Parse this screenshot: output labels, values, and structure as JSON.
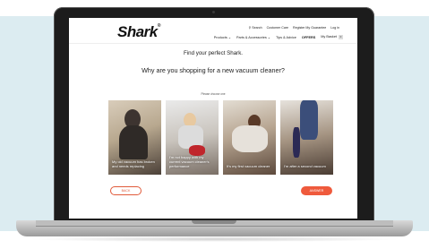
{
  "brand": {
    "logo": "Shark",
    "mark": "®"
  },
  "header": {
    "util_links": [
      "Search",
      "Customer Care",
      "Register My Guarantee",
      "Log in"
    ],
    "nav": {
      "products": "Products ⌄",
      "parts": "Parts & Accessories ⌄",
      "tips": "Tips & Advice",
      "offers": "OFFERS",
      "basket": "My Basket",
      "basket_count": "0"
    }
  },
  "main": {
    "headline": "Find your perfect Shark.",
    "question": "Why are you shopping for a new vacuum cleaner?",
    "instruction": "Please choose one",
    "cards": [
      {
        "label": "My old vacuum has broken and needs replacing"
      },
      {
        "label": "I'm not happy with my current vacuum cleaner's performance"
      },
      {
        "label": "It's my first vacuum cleaner"
      },
      {
        "label": "I'm after a second vacuum"
      }
    ]
  },
  "buttons": {
    "back": "BACK",
    "next": "ANSWER"
  },
  "colors": {
    "accent": "#ef5a3c",
    "backdrop": "#dcecf1"
  }
}
